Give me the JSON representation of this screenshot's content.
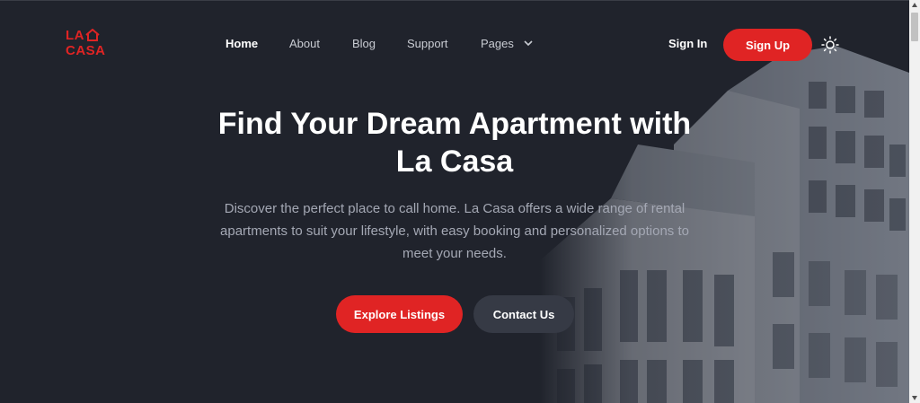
{
  "brand": {
    "line1": "LA",
    "line2": "CASA",
    "accent": "#e02424"
  },
  "nav": {
    "items": [
      {
        "label": "Home",
        "active": true
      },
      {
        "label": "About",
        "active": false
      },
      {
        "label": "Blog",
        "active": false
      },
      {
        "label": "Support",
        "active": false
      },
      {
        "label": "Pages",
        "active": false
      }
    ],
    "signin_label": "Sign In",
    "signup_label": "Sign Up",
    "theme_icon": "sun-icon"
  },
  "hero": {
    "title_line1": "Find Your Dream Apartment with",
    "title_line2": "La Casa",
    "subtitle_line1": "Discover the perfect place to call home. La Casa offers a wide range of rental",
    "subtitle_line2": "apartments to suit your lifestyle, with easy booking and personalized options to",
    "subtitle_line3": "meet your needs.",
    "primary_label": "Explore Listings",
    "secondary_label": "Contact Us"
  },
  "colors": {
    "background": "#20232c",
    "primary": "#e02424",
    "secondary": "#363a45"
  }
}
